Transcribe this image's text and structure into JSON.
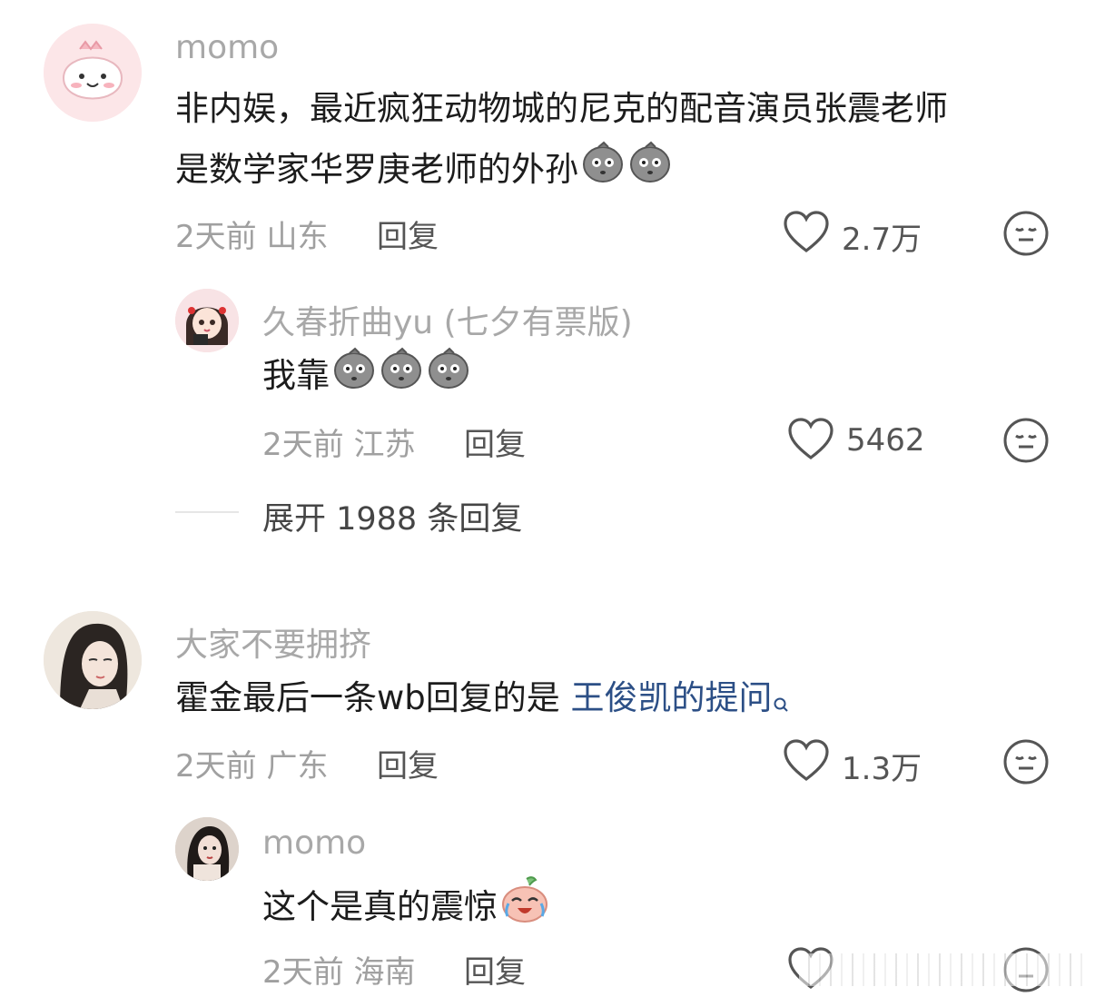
{
  "comments": [
    {
      "username": "momo",
      "text_line1": "非内娱，最近疯狂动物城的尼克的配音演员张震老师",
      "text_line2": "是数学家华罗庚老师的外孙",
      "time": "2天前",
      "location": "山东",
      "reply_label": "回复",
      "likes": "2.7万",
      "replies": [
        {
          "username": "久春折曲yu (七夕有票版)",
          "text": "我靠",
          "time": "2天前",
          "location": "江苏",
          "reply_label": "回复",
          "likes": "5462"
        }
      ],
      "expand_label": "展开 1988 条回复"
    },
    {
      "username": "大家不要拥挤",
      "text_prefix": "霍金最后一条wb回复的是 ",
      "text_link": "王俊凯的提问",
      "time": "2天前",
      "location": "广东",
      "reply_label": "回复",
      "likes": "1.3万",
      "replies": [
        {
          "username": "momo",
          "text": "这个是真的震惊",
          "time": "2天前",
          "location": "海南",
          "reply_label": "回复"
        }
      ]
    }
  ],
  "icons": {
    "like": "heart-outline-icon",
    "dislike": "neutral-face-icon",
    "emoji": "stone-face-emoji",
    "search": "search-icon"
  },
  "colors": {
    "link": "#2c4f86",
    "username": "#a8a8a8",
    "meta": "#a0a0a0"
  }
}
